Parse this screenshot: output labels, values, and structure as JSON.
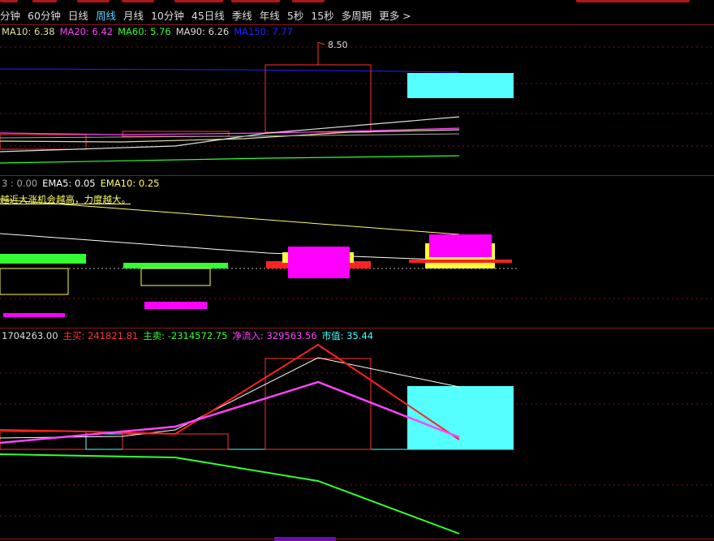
{
  "periods": [
    "分钟",
    "60分钟",
    "日线",
    "周线",
    "月线",
    "10分钟",
    "45日线",
    "季线",
    "年线",
    "5秒",
    "15秒",
    "多周期",
    "更多 >"
  ],
  "active_period": "周线",
  "ma_legend": [
    {
      "label": "MA10: 6.38",
      "color": "#e0e0a0"
    },
    {
      "label": "MA20: 6.42",
      "color": "#ff44ff"
    },
    {
      "label": "MA60: 5.76",
      "color": "#33ff33"
    },
    {
      "label": "MA90: 6.26",
      "color": "#dddddd"
    },
    {
      "label": "MA150: 7.77",
      "color": "#2222ff"
    }
  ],
  "price_peak_label": "8.50",
  "ema_legend": [
    {
      "label": "3 : 0.00",
      "color": "#aaaaaa"
    },
    {
      "label": "EMA5: 0.05",
      "color": "#ffffff"
    },
    {
      "label": "EMA10: 0.25",
      "color": "#ffff66"
    }
  ],
  "ema_note": "越近大涨机会越高，力度越大。",
  "flow_legend": [
    {
      "label": "1704263.00",
      "color": "#dddddd"
    },
    {
      "label": "主买: 241821.81",
      "color": "#ff3333"
    },
    {
      "label": "主卖: -2314572.75",
      "color": "#33ff33"
    },
    {
      "label": "净流入: 329563.56",
      "color": "#ff44ff"
    },
    {
      "label": "市值: 35.44",
      "color": "#44ffff"
    }
  ],
  "colors": {
    "grid": "#8a1a1a",
    "up": "#ff3333",
    "down": "#55ffff",
    "ma10": "#e0e0a0",
    "ma20": "#ff44ff",
    "ma60": "#33ff33",
    "ma90": "#dddddd",
    "ma150": "#2222ff"
  }
}
